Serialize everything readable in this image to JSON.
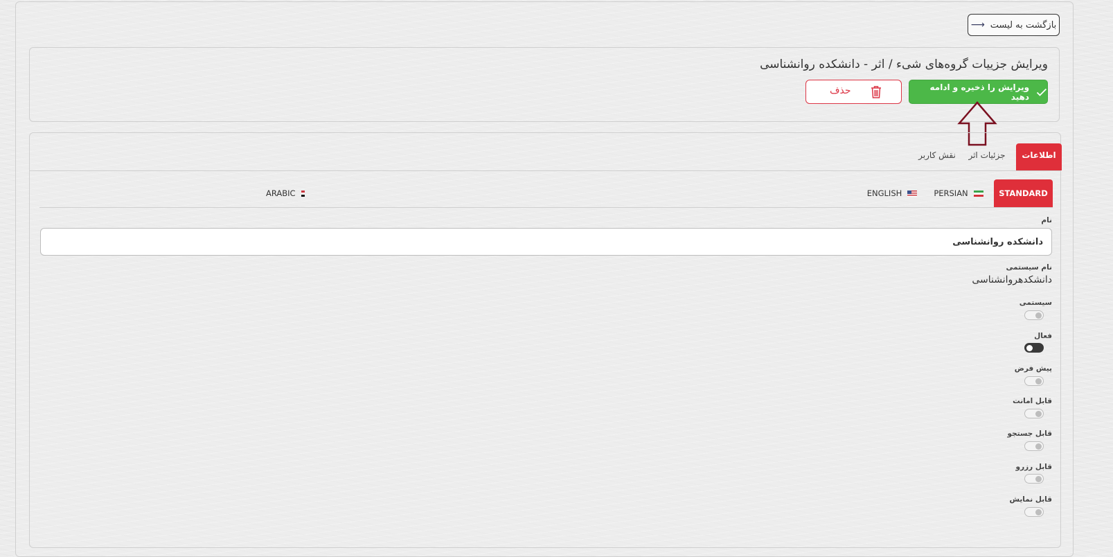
{
  "back_button": {
    "label": "بازگشت به لیست"
  },
  "header": {
    "title": "ویرایش جزییات گروه‌های شیء / اثر - دانشکده روانشناسی",
    "save_label": "ویرایش را ذخیره و ادامه دهید",
    "delete_label": "حذف"
  },
  "tabs": [
    {
      "label": "اطلاعات",
      "active": true
    },
    {
      "label": "جزئیات اثر",
      "active": false
    },
    {
      "label": "نقش کاربر",
      "active": false
    }
  ],
  "lang_tabs": [
    {
      "label": "STANDARD",
      "active": true
    },
    {
      "label": "PERSIAN",
      "flag": "iran-flag"
    },
    {
      "label": "ENGLISH",
      "flag": "usa-flag"
    },
    {
      "label": "ARABIC",
      "flag": "egypt-flag"
    }
  ],
  "form": {
    "name_label": "نام",
    "name_value": "دانشکده روانشناسی",
    "system_name_label": "نام سیستمی",
    "system_name_value": "دانشکدهروانشناسی",
    "toggles": [
      {
        "label": "سیستمی",
        "on": false
      },
      {
        "label": "فعال",
        "on": true
      },
      {
        "label": "پیش فرض",
        "on": false
      },
      {
        "label": "قابل امانت",
        "on": false
      },
      {
        "label": "قابل جستجو",
        "on": false
      },
      {
        "label": "قابل رزرو",
        "on": false
      },
      {
        "label": "قابل نمایش",
        "on": false
      }
    ]
  },
  "colors": {
    "accent_red": "#df2f3a",
    "save_green": "#4cb848",
    "annotation_arrow": "#7a1020"
  }
}
